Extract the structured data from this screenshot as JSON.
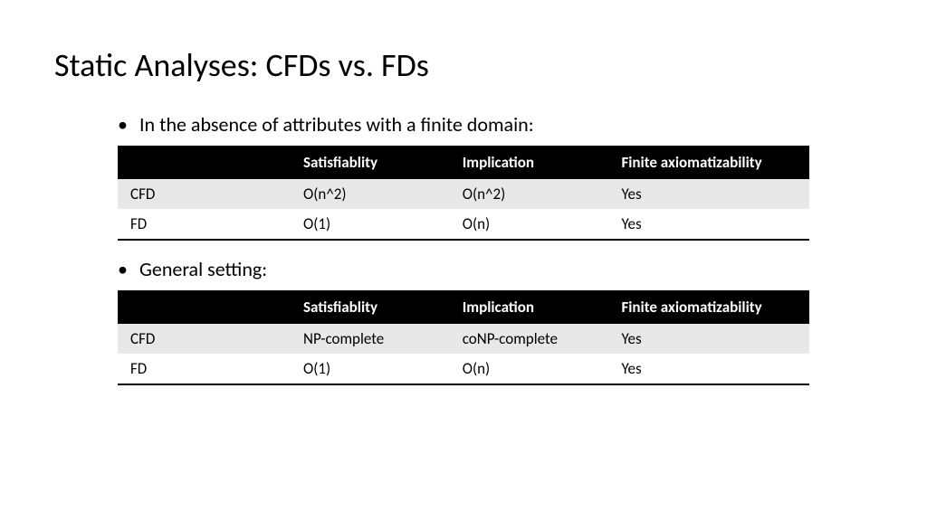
{
  "title": "Static Analyses: CFDs vs. FDs",
  "sections": [
    {
      "bullet": "In the absence of attributes with a finite domain:",
      "table": {
        "headers": [
          "",
          "Satisfiablity",
          "Implication",
          "Finite axiomatizability"
        ],
        "rows": [
          [
            "CFD",
            "O(n^2)",
            "O(n^2)",
            "Yes"
          ],
          [
            "FD",
            "O(1)",
            "O(n)",
            "Yes"
          ]
        ]
      }
    },
    {
      "bullet": "General setting:",
      "table": {
        "headers": [
          "",
          "Satisfiablity",
          "Implication",
          "Finite axiomatizability"
        ],
        "rows": [
          [
            "CFD",
            "NP-complete",
            "coNP-complete",
            "Yes"
          ],
          [
            "FD",
            "O(1)",
            "O(n)",
            "Yes"
          ]
        ]
      }
    }
  ]
}
